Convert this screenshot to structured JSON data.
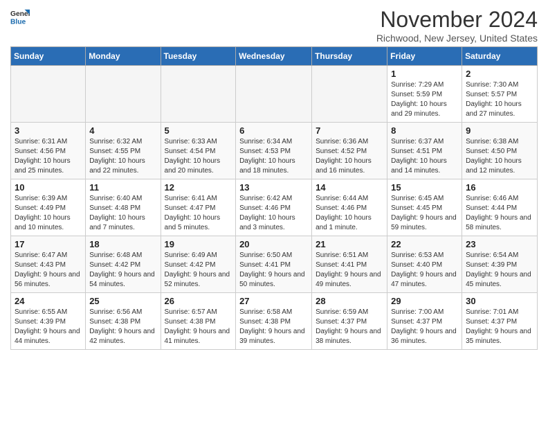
{
  "logo": {
    "line1": "General",
    "line2": "Blue"
  },
  "title": "November 2024",
  "subtitle": "Richwood, New Jersey, United States",
  "weekdays": [
    "Sunday",
    "Monday",
    "Tuesday",
    "Wednesday",
    "Thursday",
    "Friday",
    "Saturday"
  ],
  "weeks": [
    [
      {
        "day": "",
        "empty": true
      },
      {
        "day": "",
        "empty": true
      },
      {
        "day": "",
        "empty": true
      },
      {
        "day": "",
        "empty": true
      },
      {
        "day": "",
        "empty": true
      },
      {
        "day": "1",
        "sunrise": "7:29 AM",
        "sunset": "5:59 PM",
        "daylight": "10 hours and 29 minutes."
      },
      {
        "day": "2",
        "sunrise": "7:30 AM",
        "sunset": "5:57 PM",
        "daylight": "10 hours and 27 minutes."
      }
    ],
    [
      {
        "day": "3",
        "sunrise": "6:31 AM",
        "sunset": "4:56 PM",
        "daylight": "10 hours and 25 minutes."
      },
      {
        "day": "4",
        "sunrise": "6:32 AM",
        "sunset": "4:55 PM",
        "daylight": "10 hours and 22 minutes."
      },
      {
        "day": "5",
        "sunrise": "6:33 AM",
        "sunset": "4:54 PM",
        "daylight": "10 hours and 20 minutes."
      },
      {
        "day": "6",
        "sunrise": "6:34 AM",
        "sunset": "4:53 PM",
        "daylight": "10 hours and 18 minutes."
      },
      {
        "day": "7",
        "sunrise": "6:36 AM",
        "sunset": "4:52 PM",
        "daylight": "10 hours and 16 minutes."
      },
      {
        "day": "8",
        "sunrise": "6:37 AM",
        "sunset": "4:51 PM",
        "daylight": "10 hours and 14 minutes."
      },
      {
        "day": "9",
        "sunrise": "6:38 AM",
        "sunset": "4:50 PM",
        "daylight": "10 hours and 12 minutes."
      }
    ],
    [
      {
        "day": "10",
        "sunrise": "6:39 AM",
        "sunset": "4:49 PM",
        "daylight": "10 hours and 10 minutes."
      },
      {
        "day": "11",
        "sunrise": "6:40 AM",
        "sunset": "4:48 PM",
        "daylight": "10 hours and 7 minutes."
      },
      {
        "day": "12",
        "sunrise": "6:41 AM",
        "sunset": "4:47 PM",
        "daylight": "10 hours and 5 minutes."
      },
      {
        "day": "13",
        "sunrise": "6:42 AM",
        "sunset": "4:46 PM",
        "daylight": "10 hours and 3 minutes."
      },
      {
        "day": "14",
        "sunrise": "6:44 AM",
        "sunset": "4:46 PM",
        "daylight": "10 hours and 1 minute."
      },
      {
        "day": "15",
        "sunrise": "6:45 AM",
        "sunset": "4:45 PM",
        "daylight": "9 hours and 59 minutes."
      },
      {
        "day": "16",
        "sunrise": "6:46 AM",
        "sunset": "4:44 PM",
        "daylight": "9 hours and 58 minutes."
      }
    ],
    [
      {
        "day": "17",
        "sunrise": "6:47 AM",
        "sunset": "4:43 PM",
        "daylight": "9 hours and 56 minutes."
      },
      {
        "day": "18",
        "sunrise": "6:48 AM",
        "sunset": "4:42 PM",
        "daylight": "9 hours and 54 minutes."
      },
      {
        "day": "19",
        "sunrise": "6:49 AM",
        "sunset": "4:42 PM",
        "daylight": "9 hours and 52 minutes."
      },
      {
        "day": "20",
        "sunrise": "6:50 AM",
        "sunset": "4:41 PM",
        "daylight": "9 hours and 50 minutes."
      },
      {
        "day": "21",
        "sunrise": "6:51 AM",
        "sunset": "4:41 PM",
        "daylight": "9 hours and 49 minutes."
      },
      {
        "day": "22",
        "sunrise": "6:53 AM",
        "sunset": "4:40 PM",
        "daylight": "9 hours and 47 minutes."
      },
      {
        "day": "23",
        "sunrise": "6:54 AM",
        "sunset": "4:39 PM",
        "daylight": "9 hours and 45 minutes."
      }
    ],
    [
      {
        "day": "24",
        "sunrise": "6:55 AM",
        "sunset": "4:39 PM",
        "daylight": "9 hours and 44 minutes."
      },
      {
        "day": "25",
        "sunrise": "6:56 AM",
        "sunset": "4:38 PM",
        "daylight": "9 hours and 42 minutes."
      },
      {
        "day": "26",
        "sunrise": "6:57 AM",
        "sunset": "4:38 PM",
        "daylight": "9 hours and 41 minutes."
      },
      {
        "day": "27",
        "sunrise": "6:58 AM",
        "sunset": "4:38 PM",
        "daylight": "9 hours and 39 minutes."
      },
      {
        "day": "28",
        "sunrise": "6:59 AM",
        "sunset": "4:37 PM",
        "daylight": "9 hours and 38 minutes."
      },
      {
        "day": "29",
        "sunrise": "7:00 AM",
        "sunset": "4:37 PM",
        "daylight": "9 hours and 36 minutes."
      },
      {
        "day": "30",
        "sunrise": "7:01 AM",
        "sunset": "4:37 PM",
        "daylight": "9 hours and 35 minutes."
      }
    ]
  ]
}
